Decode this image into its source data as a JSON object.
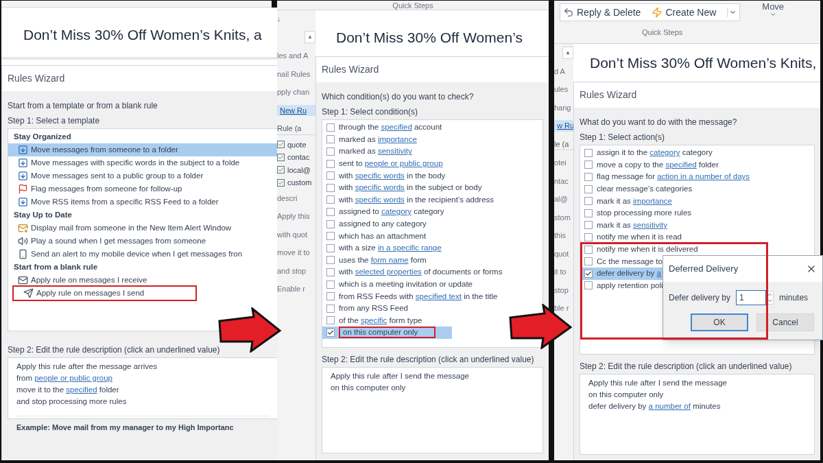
{
  "panels": [
    {
      "subject": "Don’t Miss 30% Off Women’s Knits, a",
      "dialog": {
        "title": "Rules Wizard",
        "prompt": "Start from a template or from a blank rule",
        "step1": "Step 1: Select a template",
        "groups": [
          {
            "heading": "Stay Organized",
            "items": [
              {
                "kind": "move",
                "label": "Move messages from someone to a folder",
                "selected": true,
                "highlighted": false
              },
              {
                "kind": "move",
                "label": "Move messages with specific words in the subject to a folde",
                "selected": false,
                "highlighted": false
              },
              {
                "kind": "move",
                "label": "Move messages sent to a public group to a folder",
                "selected": false,
                "highlighted": false
              },
              {
                "kind": "flag",
                "label": "Flag messages from someone for follow-up",
                "selected": false,
                "highlighted": false
              },
              {
                "kind": "move",
                "label": "Move RSS items from a specific RSS Feed to a folder",
                "selected": false,
                "highlighted": false
              }
            ]
          },
          {
            "heading": "Stay Up to Date",
            "items": [
              {
                "kind": "alert",
                "label": "Display mail from someone in the New Item Alert Window",
                "selected": false,
                "highlighted": false
              },
              {
                "kind": "sound",
                "label": "Play a sound when I get messages from someone",
                "selected": false,
                "highlighted": false
              },
              {
                "kind": "mobile",
                "label": "Send an alert to my mobile device when I get messages fron",
                "selected": false,
                "highlighted": false
              }
            ]
          },
          {
            "heading": "Start from a blank rule",
            "items": [
              {
                "kind": "receive",
                "label": "Apply rule on messages I receive",
                "selected": false,
                "highlighted": false
              },
              {
                "kind": "send",
                "label": "Apply rule on messages I send",
                "selected": false,
                "highlighted": true
              }
            ]
          }
        ],
        "step2": "Step 2: Edit the rule description (click an underlined value)",
        "description": [
          [
            {
              "text": "Apply this rule after the message arrives",
              "link": false
            }
          ],
          [
            {
              "text": "from ",
              "link": false
            },
            {
              "text": "people or public group",
              "link": true
            }
          ],
          [
            {
              "text": "move it to the ",
              "link": false
            },
            {
              "text": "specified",
              "link": true
            },
            {
              "text": " folder",
              "link": false
            }
          ],
          [
            {
              "text": "and stop processing more rules",
              "link": false
            }
          ]
        ],
        "example": "Example: Move mail from my manager to my High Importanc"
      }
    },
    {
      "ribbon": {
        "group_label": "Quick Steps"
      },
      "side_fragments": [
        {
          "text": "↓",
          "kind": "text"
        },
        {
          "text": "▲",
          "kind": "scroll"
        },
        {
          "text": "les and A",
          "kind": "text"
        },
        {
          "text": "nail Rules",
          "kind": "text"
        },
        {
          "text": "pply chan",
          "kind": "text"
        },
        {
          "text": "New Ru",
          "kind": "button"
        },
        {
          "text": "Rule (a",
          "kind": "header"
        },
        {
          "text": "quote",
          "kind": "check",
          "checked": true
        },
        {
          "text": "contac",
          "kind": "check",
          "checked": true
        },
        {
          "text": "local@",
          "kind": "check",
          "checked": true
        },
        {
          "text": "custom",
          "kind": "check",
          "checked": true
        },
        {
          "text": "descri",
          "kind": "text"
        },
        {
          "text": "Apply this",
          "kind": "text"
        },
        {
          "text": "with quot",
          "kind": "text"
        },
        {
          "text": "move it to",
          "kind": "text"
        },
        {
          "text": "and stop",
          "kind": "text"
        },
        {
          "text": "Enable r",
          "kind": "text"
        }
      ],
      "subject": "Don’t Miss 30% Off Women’s",
      "dialog": {
        "title": "Rules Wizard",
        "prompt": "Which condition(s) do you want to check?",
        "step1": "Step 1: Select condition(s)",
        "options": [
          {
            "parts": [
              {
                "text": "through the ",
                "link": false
              },
              {
                "text": "specified",
                "link": true
              },
              {
                "text": " account",
                "link": false
              }
            ],
            "checked": false,
            "selected": false,
            "highlighted": false
          },
          {
            "parts": [
              {
                "text": "marked as ",
                "link": false
              },
              {
                "text": "importance",
                "link": true
              }
            ],
            "checked": false,
            "selected": false,
            "highlighted": false
          },
          {
            "parts": [
              {
                "text": "marked as ",
                "link": false
              },
              {
                "text": "sensitivity",
                "link": true
              }
            ],
            "checked": false,
            "selected": false,
            "highlighted": false
          },
          {
            "parts": [
              {
                "text": "sent to ",
                "link": false
              },
              {
                "text": "people or public group",
                "link": true
              }
            ],
            "checked": false,
            "selected": false,
            "highlighted": false
          },
          {
            "parts": [
              {
                "text": "with ",
                "link": false
              },
              {
                "text": "specific words",
                "link": true
              },
              {
                "text": " in the body",
                "link": false
              }
            ],
            "checked": false,
            "selected": false,
            "highlighted": false
          },
          {
            "parts": [
              {
                "text": "with ",
                "link": false
              },
              {
                "text": "specific words",
                "link": true
              },
              {
                "text": " in the subject or body",
                "link": false
              }
            ],
            "checked": false,
            "selected": false,
            "highlighted": false
          },
          {
            "parts": [
              {
                "text": "with ",
                "link": false
              },
              {
                "text": "specific words",
                "link": true
              },
              {
                "text": " in the recipient’s address",
                "link": false
              }
            ],
            "checked": false,
            "selected": false,
            "highlighted": false
          },
          {
            "parts": [
              {
                "text": "assigned to ",
                "link": false
              },
              {
                "text": "category",
                "link": true
              },
              {
                "text": " category",
                "link": false
              }
            ],
            "checked": false,
            "selected": false,
            "highlighted": false
          },
          {
            "parts": [
              {
                "text": "assigned to any category",
                "link": false
              }
            ],
            "checked": false,
            "selected": false,
            "highlighted": false
          },
          {
            "parts": [
              {
                "text": "which has an attachment",
                "link": false
              }
            ],
            "checked": false,
            "selected": false,
            "highlighted": false
          },
          {
            "parts": [
              {
                "text": "with a size ",
                "link": false
              },
              {
                "text": "in a specific range",
                "link": true
              }
            ],
            "checked": false,
            "selected": false,
            "highlighted": false
          },
          {
            "parts": [
              {
                "text": "uses the ",
                "link": false
              },
              {
                "text": "form name",
                "link": true
              },
              {
                "text": " form",
                "link": false
              }
            ],
            "checked": false,
            "selected": false,
            "highlighted": false
          },
          {
            "parts": [
              {
                "text": "with ",
                "link": false
              },
              {
                "text": "selected properties",
                "link": true
              },
              {
                "text": " of documents or forms",
                "link": false
              }
            ],
            "checked": false,
            "selected": false,
            "highlighted": false
          },
          {
            "parts": [
              {
                "text": "which is a meeting invitation or update",
                "link": false
              }
            ],
            "checked": false,
            "selected": false,
            "highlighted": false
          },
          {
            "parts": [
              {
                "text": "from RSS Feeds with ",
                "link": false
              },
              {
                "text": "specified text",
                "link": true
              },
              {
                "text": " in the title",
                "link": false
              }
            ],
            "checked": false,
            "selected": false,
            "highlighted": false
          },
          {
            "parts": [
              {
                "text": "from any RSS Feed",
                "link": false
              }
            ],
            "checked": false,
            "selected": false,
            "highlighted": false
          },
          {
            "parts": [
              {
                "text": "of the ",
                "link": false
              },
              {
                "text": "specific",
                "link": true
              },
              {
                "text": " form type",
                "link": false
              }
            ],
            "checked": false,
            "selected": false,
            "highlighted": false
          },
          {
            "parts": [
              {
                "text": "on this computer only",
                "link": false
              }
            ],
            "checked": true,
            "selected": true,
            "highlighted": true
          }
        ],
        "step2": "Step 2: Edit the rule description (click an underlined value)",
        "description": [
          [
            {
              "text": "Apply this rule after I send the message",
              "link": false
            }
          ],
          [
            {
              "text": "on this computer only",
              "link": false
            }
          ]
        ]
      }
    },
    {
      "ribbon": {
        "buttons": [
          {
            "label": "Reply & Delete"
          },
          {
            "label": "Create New"
          }
        ],
        "group_label": "Quick Steps",
        "move_label": "Move"
      },
      "side_fragments": [
        {
          "text": "▲",
          "kind": "scroll"
        },
        {
          "text": "d A",
          "kind": "text"
        },
        {
          "text": "ules",
          "kind": "text"
        },
        {
          "text": "hang",
          "kind": "text"
        },
        {
          "text": "w Ru",
          "kind": "button"
        },
        {
          "text": "le (a",
          "kind": "header"
        },
        {
          "text": "otei",
          "kind": "text"
        },
        {
          "text": "ntac",
          "kind": "text"
        },
        {
          "text": "al@",
          "kind": "text"
        },
        {
          "text": "stom",
          "kind": "text"
        },
        {
          "text": "this",
          "kind": "text"
        },
        {
          "text": "quot",
          "kind": "text"
        },
        {
          "text": "it to",
          "kind": "text"
        },
        {
          "text": "stop",
          "kind": "text"
        },
        {
          "text": "ble r",
          "kind": "text"
        }
      ],
      "subject": "Don’t Miss 30% Off Women’s Knits,",
      "dialog": {
        "title": "Rules Wizard",
        "prompt": "What do you want to do with the message?",
        "step1": "Step 1: Select action(s)",
        "options": [
          {
            "parts": [
              {
                "text": "assign it to the ",
                "link": false
              },
              {
                "text": "category",
                "link": true
              },
              {
                "text": " category",
                "link": false
              }
            ],
            "checked": false,
            "selected": false,
            "highlighted": false
          },
          {
            "parts": [
              {
                "text": "move a copy to the ",
                "link": false
              },
              {
                "text": "specified",
                "link": true
              },
              {
                "text": " folder",
                "link": false
              }
            ],
            "checked": false,
            "selected": false,
            "highlighted": false
          },
          {
            "parts": [
              {
                "text": "flag message for ",
                "link": false
              },
              {
                "text": "action in a number of days",
                "link": true
              }
            ],
            "checked": false,
            "selected": false,
            "highlighted": false
          },
          {
            "parts": [
              {
                "text": "clear message’s categories",
                "link": false
              }
            ],
            "checked": false,
            "selected": false,
            "highlighted": false
          },
          {
            "parts": [
              {
                "text": "mark it as ",
                "link": false
              },
              {
                "text": "importance",
                "link": true
              }
            ],
            "checked": false,
            "selected": false,
            "highlighted": false
          },
          {
            "parts": [
              {
                "text": "stop processing more rules",
                "link": false
              }
            ],
            "checked": false,
            "selected": false,
            "highlighted": false
          },
          {
            "parts": [
              {
                "text": "mark it as ",
                "link": false
              },
              {
                "text": "sensitivity",
                "link": true
              }
            ],
            "checked": false,
            "selected": false,
            "highlighted": false
          },
          {
            "parts": [
              {
                "text": "notify me when it is read",
                "link": false
              }
            ],
            "checked": false,
            "selected": false,
            "highlighted": false
          },
          {
            "parts": [
              {
                "text": "notify me when it is delivered",
                "link": false
              }
            ],
            "checked": false,
            "selected": false,
            "highlighted": false
          },
          {
            "parts": [
              {
                "text": "Cc the message to",
                "link": false
              }
            ],
            "checked": false,
            "selected": false,
            "highlighted": false
          },
          {
            "parts": [
              {
                "text": "defer delivery by ",
                "link": false
              },
              {
                "text": "a",
                "link": true
              }
            ],
            "checked": true,
            "selected": true,
            "highlighted": false
          },
          {
            "parts": [
              {
                "text": "apply retention poli",
                "link": false
              }
            ],
            "checked": false,
            "selected": false,
            "highlighted": false
          }
        ],
        "step2": "Step 2: Edit the rule description (click an underlined value)",
        "description": [
          [
            {
              "text": "Apply this rule after I send the message",
              "link": false
            }
          ],
          [
            {
              "text": "on this computer only",
              "link": false
            }
          ],
          [
            {
              "text": "defer delivery by ",
              "link": false
            },
            {
              "text": "a number of",
              "link": true
            },
            {
              "text": " minutes",
              "link": false
            }
          ]
        ]
      },
      "popup": {
        "title": "Deferred Delivery",
        "field_label": "Defer delivery by",
        "value": "1",
        "unit": "minutes",
        "ok": "OK",
        "cancel": "Cancel"
      },
      "highlight_frame": true
    }
  ]
}
